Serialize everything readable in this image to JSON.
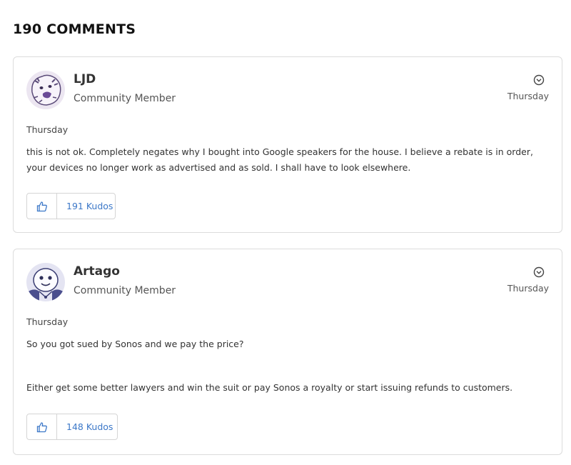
{
  "comments_heading": "190 COMMENTS",
  "colors": {
    "accent": "#3c78c8",
    "border": "#dcdcdc"
  },
  "comments": [
    {
      "author": "LJD",
      "role": "Community Member",
      "date_header": "Thursday",
      "date_post": "Thursday",
      "paragraphs": [
        "this is not ok. Completely negates why  I bought into Google speakers for the house. I believe a rebate is in order, your devices no longer work as advertised and as sold. I shall have to look elsewhere."
      ],
      "kudos_label": "191 Kudos",
      "avatar_icon": "dog-avatar-icon"
    },
    {
      "author": "Artago",
      "role": "Community Member",
      "date_header": "Thursday",
      "date_post": "Thursday",
      "paragraphs": [
        "So you got sued by Sonos and we pay the price?",
        "Either get some better lawyers and win the suit or pay Sonos a royalty or start issuing refunds to customers."
      ],
      "kudos_label": "148 Kudos",
      "avatar_icon": "face-avatar-icon"
    }
  ]
}
